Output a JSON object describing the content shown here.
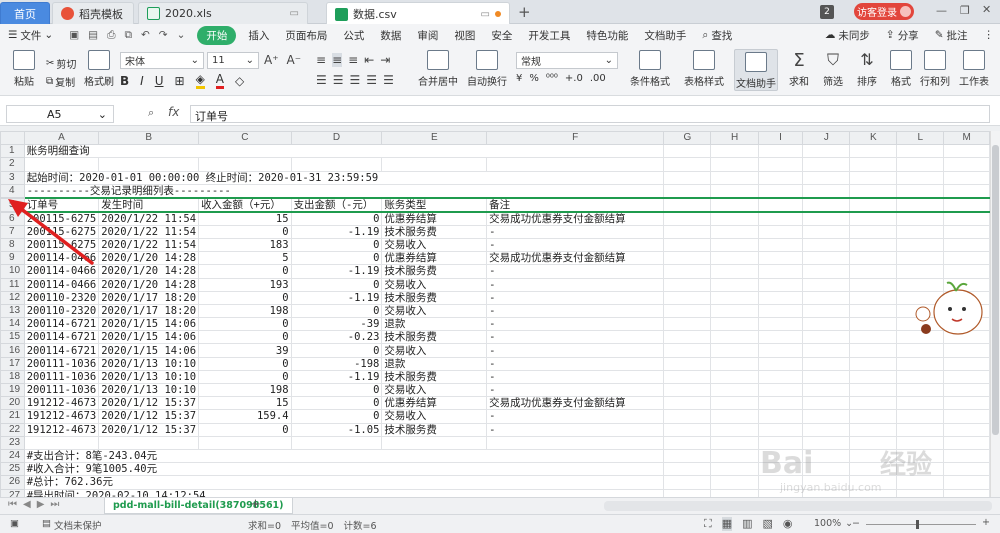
{
  "tabs": [
    {
      "label": "首页",
      "icon": "home"
    },
    {
      "label": "稻壳模板",
      "icon": "docer-icon"
    },
    {
      "label": "2020.xls",
      "icon": "excel-file-icon"
    },
    {
      "label": "数据.csv",
      "icon": "excel-file-icon"
    }
  ],
  "tab_add": "+",
  "window": {
    "badge": "2",
    "login": "访客登录"
  },
  "menu": {
    "file": "文件",
    "items": [
      "插入",
      "页面布局",
      "公式",
      "数据",
      "审阅",
      "视图",
      "安全",
      "开发工具",
      "特色功能",
      "文档助手"
    ],
    "start": "开始",
    "search": "查找",
    "sync": "未同步",
    "share": "分享",
    "comment": "批注"
  },
  "ribbon": {
    "cut": "剪切",
    "copy": "复制",
    "format_painter": "格式刷",
    "paste": "粘贴",
    "font": "宋体",
    "size": "11",
    "bold": "B",
    "italic": "I",
    "underline": "U",
    "merge": "合并居中",
    "wrap": "自动换行",
    "number_format": "常规",
    "cond_format": "条件格式",
    "table_style": "表格样式",
    "doc_helper": "文档助手",
    "sum": "求和",
    "filter": "筛选",
    "sort": "排序",
    "format": "格式",
    "rowcol": "行和列",
    "worksheet": "工作表"
  },
  "formula_bar": {
    "cell_ref": "A5",
    "fx": "fx",
    "content": "订单号"
  },
  "columns": [
    "A",
    "B",
    "C",
    "D",
    "E",
    "F",
    "G",
    "H",
    "I",
    "J",
    "K",
    "L",
    "M"
  ],
  "rows": [
    {
      "n": "1",
      "cells": [
        "账务明细查询",
        "",
        "",
        "",
        "",
        ""
      ]
    },
    {
      "n": "2",
      "cells": [
        "",
        "",
        "",
        "",
        "",
        ""
      ]
    },
    {
      "n": "3",
      "cells": [
        "起始时间：2020-01-01 00:00:00  终止时间：2020-01-31 23:59:59",
        "",
        "",
        "",
        "",
        ""
      ]
    },
    {
      "n": "4",
      "cells": [
        "----------交易记录明细列表---------",
        "",
        "",
        "",
        "",
        ""
      ]
    },
    {
      "n": "5",
      "cells": [
        "订单号",
        "发生时间",
        "收入金额（+元）",
        "支出金额（-元）",
        "账务类型",
        "备注"
      ]
    },
    {
      "n": "6",
      "cells": [
        "200115-6275",
        "2020/1/22 11:54",
        "15",
        "0",
        "优惠券结算",
        "交易成功优惠券支付金额结算"
      ]
    },
    {
      "n": "7",
      "cells": [
        "200115-6275",
        "2020/1/22 11:54",
        "0",
        "-1.19",
        "技术服务费",
        "-"
      ]
    },
    {
      "n": "8",
      "cells": [
        "200115-6275",
        "2020/1/22 11:54",
        "183",
        "0",
        "交易收入",
        "-"
      ]
    },
    {
      "n": "9",
      "cells": [
        "200114-0466",
        "2020/1/20 14:28",
        "5",
        "0",
        "优惠券结算",
        "交易成功优惠券支付金额结算"
      ]
    },
    {
      "n": "10",
      "cells": [
        "200114-0466",
        "2020/1/20 14:28",
        "0",
        "-1.19",
        "技术服务费",
        "-"
      ]
    },
    {
      "n": "11",
      "cells": [
        "200114-0466",
        "2020/1/20 14:28",
        "193",
        "0",
        "交易收入",
        "-"
      ]
    },
    {
      "n": "12",
      "cells": [
        "200110-2320",
        "2020/1/17 18:20",
        "0",
        "-1.19",
        "技术服务费",
        "-"
      ]
    },
    {
      "n": "13",
      "cells": [
        "200110-2320",
        "2020/1/17 18:20",
        "198",
        "0",
        "交易收入",
        "-"
      ]
    },
    {
      "n": "14",
      "cells": [
        "200114-6721",
        "2020/1/15 14:06",
        "0",
        "-39",
        "退款",
        "-"
      ]
    },
    {
      "n": "15",
      "cells": [
        "200114-6721",
        "2020/1/15 14:06",
        "0",
        "-0.23",
        "技术服务费",
        "-"
      ]
    },
    {
      "n": "16",
      "cells": [
        "200114-6721",
        "2020/1/15 14:06",
        "39",
        "0",
        "交易收入",
        "-"
      ]
    },
    {
      "n": "17",
      "cells": [
        "200111-1036",
        "2020/1/13 10:10",
        "0",
        "-198",
        "退款",
        "-"
      ]
    },
    {
      "n": "18",
      "cells": [
        "200111-1036",
        "2020/1/13 10:10",
        "0",
        "-1.19",
        "技术服务费",
        "-"
      ]
    },
    {
      "n": "19",
      "cells": [
        "200111-1036",
        "2020/1/13 10:10",
        "198",
        "0",
        "交易收入",
        "-"
      ]
    },
    {
      "n": "20",
      "cells": [
        "191212-4673",
        "2020/1/12 15:37",
        "15",
        "0",
        "优惠券结算",
        "交易成功优惠券支付金额结算"
      ]
    },
    {
      "n": "21",
      "cells": [
        "191212-4673",
        "2020/1/12 15:37",
        "159.4",
        "0",
        "交易收入",
        "-"
      ]
    },
    {
      "n": "22",
      "cells": [
        "191212-4673",
        "2020/1/12 15:37",
        "0",
        "-1.05",
        "技术服务费",
        "-"
      ]
    },
    {
      "n": "23",
      "cells": [
        "",
        "",
        "",
        "",
        "",
        ""
      ]
    },
    {
      "n": "24",
      "cells": [
        "#支出合计：8笔-243.04元",
        "",
        "",
        "",
        "",
        ""
      ]
    },
    {
      "n": "25",
      "cells": [
        "#收入合计：9笔1005.40元",
        "",
        "",
        "",
        "",
        ""
      ]
    },
    {
      "n": "26",
      "cells": [
        "#总计：762.36元",
        "",
        "",
        "",
        "",
        ""
      ]
    },
    {
      "n": "27",
      "cells": [
        "#导出时间：2020-02-10 14:12:54",
        "",
        "",
        "",
        "",
        ""
      ]
    }
  ],
  "sheet_tab": "pdd-mall-bill-detail(387098561)",
  "status": {
    "protect": "文档未保护",
    "sum": "求和=0",
    "avg": "平均值=0",
    "count": "计数=6",
    "zoom": "100%"
  },
  "watermark": {
    "line1": "Bai",
    "line2": "经验",
    "url": "jingyan.baidu.com"
  },
  "colors": {
    "accent_green": "#1f9b4e",
    "home_tab": "#4a8ae0",
    "arrow_red": "#e02020",
    "login_red": "#e2463c"
  }
}
